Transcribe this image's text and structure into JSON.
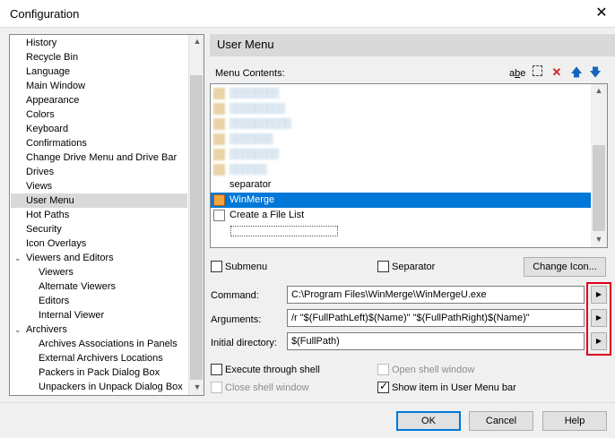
{
  "window": {
    "title": "Configuration",
    "close_glyph": "✕"
  },
  "tree": {
    "items": [
      {
        "label": "History",
        "indent": 0
      },
      {
        "label": "Recycle Bin",
        "indent": 0
      },
      {
        "label": "Language",
        "indent": 0
      },
      {
        "label": "Main Window",
        "indent": 0
      },
      {
        "label": "Appearance",
        "indent": 0
      },
      {
        "label": "Colors",
        "indent": 0
      },
      {
        "label": "Keyboard",
        "indent": 0
      },
      {
        "label": "Confirmations",
        "indent": 0
      },
      {
        "label": "Change Drive Menu and Drive Bar",
        "indent": 0
      },
      {
        "label": "Drives",
        "indent": 0
      },
      {
        "label": "Views",
        "indent": 0
      },
      {
        "label": "User Menu",
        "indent": 0,
        "selected": true
      },
      {
        "label": "Hot Paths",
        "indent": 0
      },
      {
        "label": "Security",
        "indent": 0
      },
      {
        "label": "Icon Overlays",
        "indent": 0
      },
      {
        "label": "Viewers and Editors",
        "indent": 0,
        "expanded": true
      },
      {
        "label": "Viewers",
        "indent": 1
      },
      {
        "label": "Alternate Viewers",
        "indent": 1
      },
      {
        "label": "Editors",
        "indent": 1
      },
      {
        "label": "Internal Viewer",
        "indent": 1
      },
      {
        "label": "Archivers",
        "indent": 0,
        "expanded": true
      },
      {
        "label": "Archives Associations in Panels",
        "indent": 1
      },
      {
        "label": "External Archivers Locations",
        "indent": 1
      },
      {
        "label": "Packers in Pack Dialog Box",
        "indent": 1
      },
      {
        "label": "Unpackers in Unpack Dialog Box",
        "indent": 1
      }
    ]
  },
  "panel": {
    "title": "User Menu",
    "menu_contents_label": "Menu Contents:",
    "toolbar_icons": [
      "rename-icon",
      "new-item-icon",
      "delete-icon",
      "move-up-icon",
      "move-down-icon"
    ],
    "list_items": [
      {
        "label": "▒▒▒▒▒▒▒▒",
        "blurred": true
      },
      {
        "label": "▒▒▒▒▒▒▒▒▒",
        "blurred": true
      },
      {
        "label": "▒▒▒▒▒▒▒▒▒▒",
        "blurred": true
      },
      {
        "label": "▒▒▒▒▒▒▒",
        "blurred": true
      },
      {
        "label": "▒▒▒▒▒▒▒▒",
        "blurred": true
      },
      {
        "label": "▒▒▒▒▒▒",
        "blurred": true
      },
      {
        "label": "separator"
      },
      {
        "label": "WinMerge",
        "selected": true
      },
      {
        "label": "Create a File List"
      }
    ],
    "submenu_label": "Submenu",
    "separator_label": "Separator",
    "change_icon_label": "Change Icon...",
    "command_label": "Command:",
    "command_value": "C:\\Program Files\\WinMerge\\WinMergeU.exe",
    "arguments_label": "Arguments:",
    "arguments_value": "/r \"$(FullPathLeft)$(Name)\" \"$(FullPathRight)$(Name)\"",
    "initial_dir_label": "Initial directory:",
    "initial_dir_value": "$(FullPath)",
    "execute_shell_label": "Execute through shell",
    "open_shell_label": "Open shell window",
    "close_shell_label": "Close shell window",
    "show_in_bar_label": "Show item in User Menu bar",
    "arrow_glyph": "▶"
  },
  "buttons": {
    "ok": "OK",
    "cancel": "Cancel",
    "help": "Help"
  },
  "colors": {
    "selection": "#0078d7",
    "highlight_frame": "#e0001b"
  }
}
